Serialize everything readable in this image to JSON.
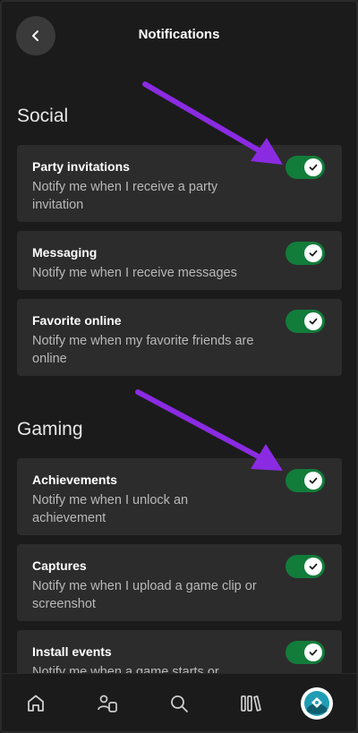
{
  "header": {
    "title": "Notifications",
    "back_icon": "chevron-left-icon"
  },
  "sections": [
    {
      "title": "Social",
      "items": [
        {
          "title": "Party invitations",
          "description": "Notify me when I receive a party invitation",
          "enabled": true
        },
        {
          "title": "Messaging",
          "description": "Notify me when I receive messages",
          "enabled": true
        },
        {
          "title": "Favorite online",
          "description": "Notify me when my favorite friends are online",
          "enabled": true
        }
      ]
    },
    {
      "title": "Gaming",
      "items": [
        {
          "title": "Achievements",
          "description": "Notify me when I unlock an achievement",
          "enabled": true
        },
        {
          "title": "Captures",
          "description": "Notify me when I upload a game clip or screenshot",
          "enabled": true
        },
        {
          "title": "Install events",
          "description": "Notify me when a game starts or",
          "enabled": true
        }
      ]
    }
  ],
  "bottom_nav": {
    "items": [
      "home-icon",
      "people-icon",
      "search-icon",
      "library-icon",
      "profile-avatar-icon"
    ]
  },
  "colors": {
    "background": "#1b1b1b",
    "card": "#2c2c2c",
    "toggle_on": "#127c3b",
    "annotation_arrow": "#8a2be2"
  }
}
